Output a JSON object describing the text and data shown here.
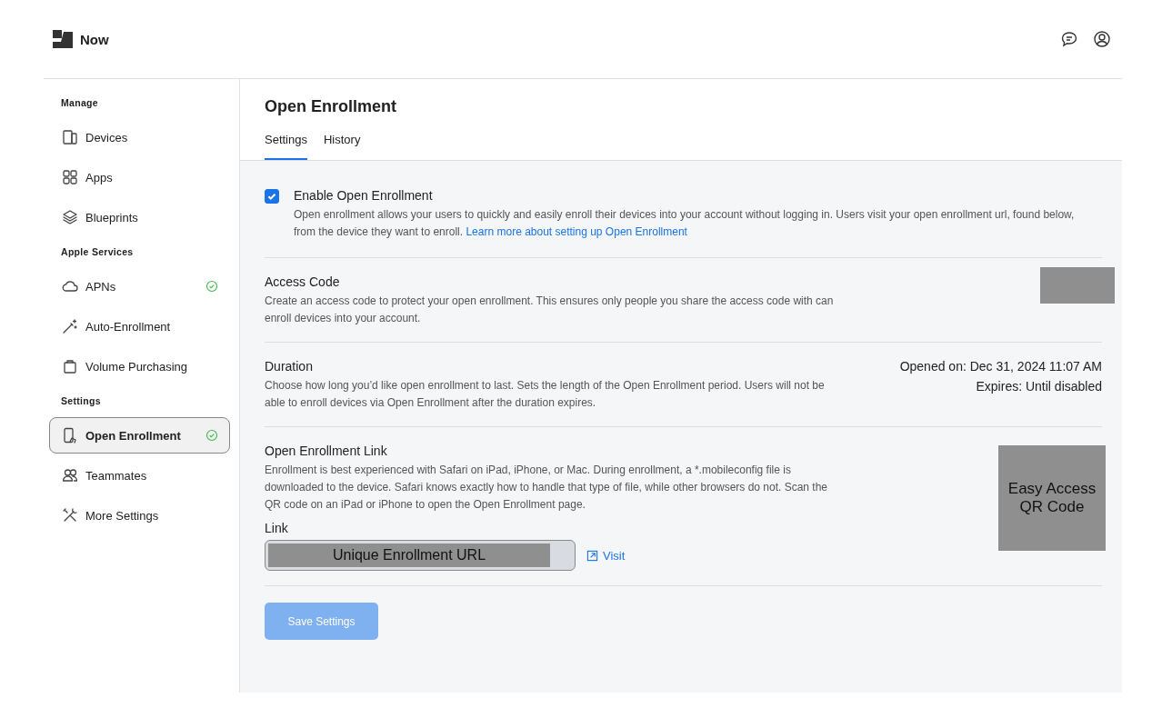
{
  "header": {
    "brand": "Now"
  },
  "sidebar": {
    "sections": [
      {
        "title": "Manage",
        "items": [
          {
            "label": "Devices",
            "selected": false,
            "verified": false
          },
          {
            "label": "Apps",
            "selected": false,
            "verified": false
          },
          {
            "label": "Blueprints",
            "selected": false,
            "verified": false
          }
        ]
      },
      {
        "title": "Apple Services",
        "items": [
          {
            "label": "APNs",
            "selected": false,
            "verified": true
          },
          {
            "label": "Auto-Enrollment",
            "selected": false,
            "verified": false
          },
          {
            "label": "Volume Purchasing",
            "selected": false,
            "verified": false
          }
        ]
      },
      {
        "title": "Settings",
        "items": [
          {
            "label": "Open Enrollment",
            "selected": true,
            "verified": true
          },
          {
            "label": "Teammates",
            "selected": false,
            "verified": false
          },
          {
            "label": "More Settings",
            "selected": false,
            "verified": false
          }
        ]
      }
    ]
  },
  "page": {
    "title": "Open Enrollment",
    "tabs": [
      {
        "label": "Settings",
        "selected": true
      },
      {
        "label": "History",
        "selected": false
      }
    ]
  },
  "enable": {
    "label": "Enable Open Enrollment",
    "checked": true,
    "description": "Open enrollment allows your users to quickly and easily enroll their devices into your account without logging in. Users visit your open enrollment url, found below, from the device they want to enroll.",
    "link": "Learn more about setting up Open Enrollment"
  },
  "access_code": {
    "title": "Access Code",
    "description": "Create an access code to protect your open enrollment. This ensures only people you share the access code with can enroll devices into your account."
  },
  "duration": {
    "title": "Duration",
    "description": "Choose how long you’d like open enrollment to last. Sets the length of the Open Enrollment period. Users will not be able to enroll devices via Open Enrollment after the duration expires.",
    "opened_on": "Opened on: Dec 31, 2024 11:07 AM",
    "expires": "Expires: Until disabled"
  },
  "enrollment_link": {
    "title": "Open Enrollment Link",
    "description": "Enrollment is best experienced with Safari on iPad, iPhone, or Mac. During enrollment, a *.mobileconfig file is downloaded to the device. Safari knows exactly how to handle that type of file, while other browsers do not. Scan the QR code on an iPad or iPhone to open the Open Enrollment page.",
    "link_label": "Link",
    "url_value": "Unique Enrollment URL",
    "visit": "Visit",
    "qr_caption": "Easy Access QR Code"
  },
  "save_button": {
    "label": "Save Settings",
    "disabled": true
  }
}
